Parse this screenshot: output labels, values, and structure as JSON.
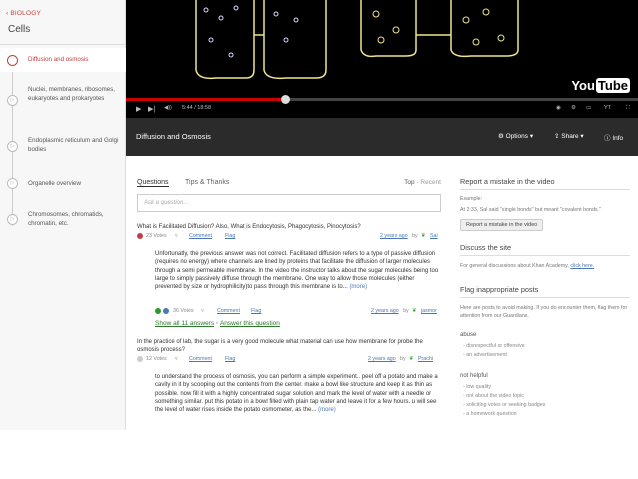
{
  "sidebar": {
    "breadcrumb": "‹ BIOLOGY",
    "title": "Cells",
    "items": [
      {
        "label": "Diffusion and osmosis",
        "active": true
      },
      {
        "label": "Nuclei, membranes, ribosomes, eukaryotes and prokaryotes",
        "active": false
      },
      {
        "label": "Endoplasmic reticulum and Golgi bodies",
        "active": false
      },
      {
        "label": "Organelle overview",
        "active": false
      },
      {
        "label": "Chromosomes, chromatids, chromatin, etc.",
        "active": false
      }
    ]
  },
  "video": {
    "time": "5:44 / 18:58",
    "progress": 0.31,
    "logo_you": "You",
    "logo_tube": "Tube",
    "title": "Diffusion and Osmosis",
    "options_label": "Options ▾",
    "share_label": "Share ▾",
    "info_label": "Info"
  },
  "questions": {
    "tab_questions": "Questions",
    "tab_tips": "Tips & Thanks",
    "sort_top": "Top",
    "sort_sep": "·",
    "sort_recent": "Recent",
    "ask_placeholder": "Ask a question...",
    "q1": {
      "text": "What is Facilitated Diffusion? Also, What is Endocytosis, Phagocytosis, Pinocytosis?",
      "votes": "23 Votes",
      "comment": "Comment",
      "flag": "Flag",
      "ago": "2 years ago",
      "by": "by",
      "user": "Sai"
    },
    "a1": {
      "text": "Unfortunatly, the previous answer was not correct. Facilitated diffusion refers to a type of passive diffusion (requires no energy) where channels are lined by proteins that facilitate the diffusion of larger molecules through a semi permeable membrane. In the video the instructor talks about the sugar molecules being too large to simply passively diffuse through the membrane. One way to allow those molecules (either prevented by size or hydrophilicity)to pass through this membrane is to...",
      "more": "(more)",
      "votes": "36 Votes",
      "comment": "Comment",
      "flag": "Flag",
      "ago": "2 years ago",
      "by": "by",
      "user": "jasmor"
    },
    "show_all": "Show all 11 answers",
    "answer_this": "Answer this question",
    "q2": {
      "text": "In the practice of lab, the sugar is a very good molecule what material can use how membrane for probe the osmosis process?",
      "votes": "12 Votes",
      "comment": "Comment",
      "flag": "Flag",
      "ago": "2 years ago",
      "by": "by",
      "user": "Prachi"
    },
    "a2": {
      "text": "to understand the process of osmosis, you can perform a simple experiment.. peel off a potato and make a cavity in it by scooping out the contents from the center. make a bowl like structure and keep it as thin as possible. now fill it with a highly concentrated sugar solution and mark the level of water with a needle or something similar. put this potato in a bowl filled with plain tap water and leave it for a few hours. u will see the level of water rises inside the potato osmometer, as the...",
      "more": "(more)"
    }
  },
  "right": {
    "report_title": "Report a mistake in the video",
    "report_example": "Example:",
    "report_desc": "At 2:33, Sal said \"single bonds\" but meant \"covalent bonds.\"",
    "report_button": "Report a mistake in the video",
    "discuss_title": "Discuss the site",
    "discuss_text": "For general discussions about Khan Academy,",
    "discuss_link": "click here.",
    "flag_title": "Flag inappropriate posts",
    "flag_text": "Here are posts to avoid making. If you do encounter them, flag them for attention from our Guardians.",
    "abuse_title": "abuse",
    "abuse_items": [
      "- disrespectful or offensive",
      "- an advertisement"
    ],
    "nothelpful_title": "not helpful",
    "nothelpful_items": [
      "- low quality",
      "- not about the video topic",
      "- soliciting votes or seeking badges",
      "- a homework question"
    ]
  },
  "colors": {
    "accent": "#c23e3e",
    "link": "#4a77b4",
    "green": "#2a7a2a"
  }
}
